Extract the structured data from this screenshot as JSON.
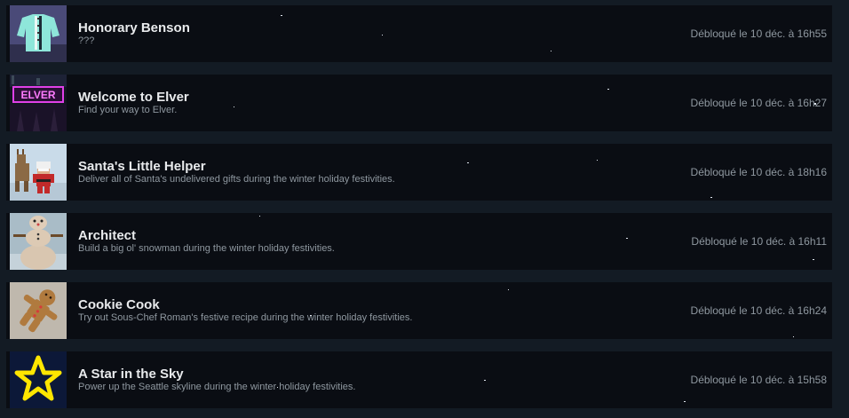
{
  "achievements": [
    {
      "title": "Honorary Benson",
      "description": "???",
      "unlocked": "Débloqué le 10 déc. à 16h55",
      "icon": "teal-jacket-icon"
    },
    {
      "title": "Welcome to Elver",
      "description": "Find your way to Elver.",
      "unlocked": "Débloqué le 10 déc. à 16h27",
      "icon": "elver-neon-sign-icon"
    },
    {
      "title": "Santa's Little Helper",
      "description": "Deliver all of Santa's undelivered gifts during the winter holiday festivities.",
      "unlocked": "Débloqué le 10 déc. à 18h16",
      "icon": "santa-and-reindeer-icon"
    },
    {
      "title": "Architect",
      "description": "Build a big ol' snowman during the winter holiday festivities.",
      "unlocked": "Débloqué le 10 déc. à 16h11",
      "icon": "snowman-icon"
    },
    {
      "title": "Cookie Cook",
      "description": "Try out Sous-Chef Roman's festive recipe during the winter holiday festivities.",
      "unlocked": "Débloqué le 10 déc. à 16h24",
      "icon": "gingerbread-cookie-icon"
    },
    {
      "title": "A Star in the Sky",
      "description": "Power up the Seattle skyline during the winter holiday festivities.",
      "unlocked": "Débloqué le 10 déc. à 15h58",
      "icon": "yellow-star-icon"
    }
  ],
  "icon_text": {
    "elver_sign": "ELVER"
  },
  "colors": {
    "page_background": "#131b24",
    "row_background": "#0a0d13",
    "title_text": "#e8eaec",
    "secondary_text": "#8f98a0",
    "star_yellow": "#ffe600",
    "neon_magenta": "#e040e8"
  }
}
